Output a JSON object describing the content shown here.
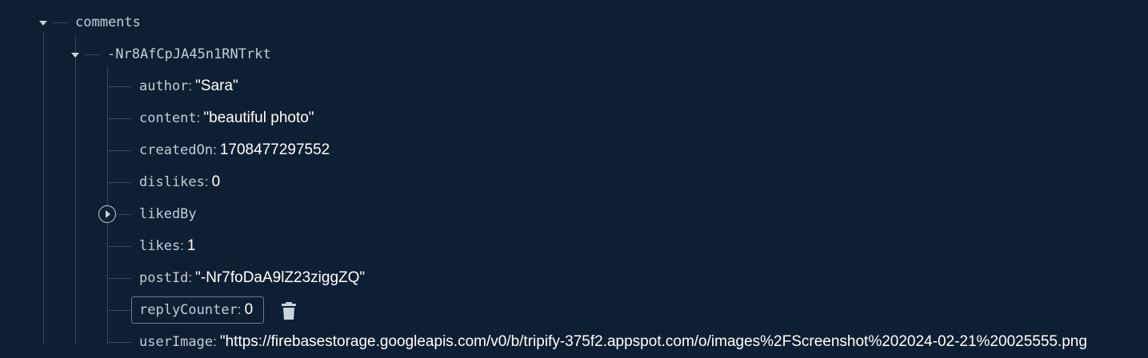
{
  "tree": {
    "root_key": "comments",
    "child_key": "-Nr8AfCpJA45n1RNTrkt",
    "fields": [
      {
        "key": "author",
        "value": "\"Sara\""
      },
      {
        "key": "content",
        "value": "\"beautiful photo\""
      },
      {
        "key": "createdOn",
        "value": "1708477297552"
      },
      {
        "key": "dislikes",
        "value": "0"
      },
      {
        "key": "likedBy",
        "value": ""
      },
      {
        "key": "likes",
        "value": "1"
      },
      {
        "key": "postId",
        "value": "\"-Nr7foDaA9lZ23ziggZQ\""
      },
      {
        "key": "replyCounter",
        "value": "0"
      },
      {
        "key": "userImage",
        "value": "\"https://firebasestorage.googleapis.com/v0/b/tripify-375f2.appspot.com/o/images%2FScreenshot%202024-02-21%20025555.png"
      }
    ]
  },
  "colors": {
    "background": "#0f1f33",
    "text": "#ffffff",
    "key": "#c3ccd7",
    "guide": "#32475f"
  },
  "icons": {
    "expand_collapse": "caret-down-icon",
    "collapsed": "chevron-right-circle-icon",
    "delete": "trash-icon"
  }
}
